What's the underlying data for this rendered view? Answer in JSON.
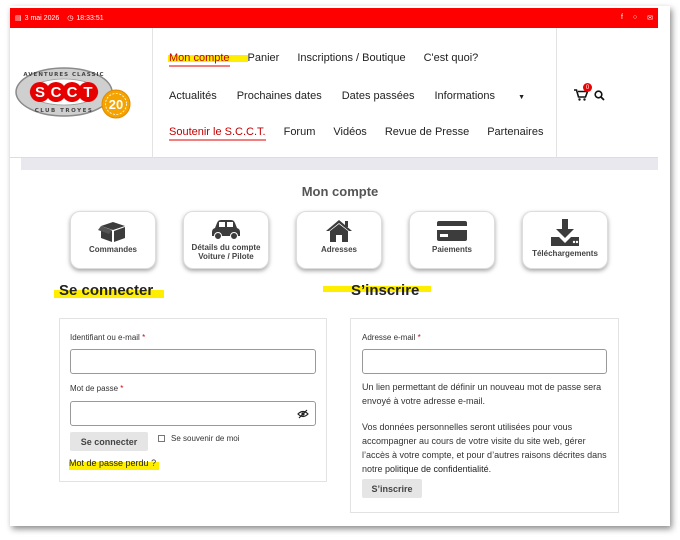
{
  "topbar": {
    "date": "3 mai 2026",
    "time": "18:33:51",
    "social_icons": [
      "facebook-icon",
      "instagram-icon",
      "mail-icon"
    ]
  },
  "logo": {
    "arc_top": "AVENTURES CLASSIC",
    "arc_bottom": "CLUB TROYES",
    "main": "SCCT",
    "badge": "20"
  },
  "nav": {
    "row1": [
      "Mon compte",
      "Panier",
      "Inscriptions / Boutique",
      "C'est quoi?"
    ],
    "row2": [
      "Actualités",
      "Prochaines dates",
      "Dates passées",
      "Informations"
    ],
    "row3": [
      "Soutenir le S.C.C.T.",
      "Forum",
      "Vidéos",
      "Revue de Presse",
      "Partenaires"
    ],
    "cart_count": "0"
  },
  "page_title": "Mon compte",
  "tiles": [
    {
      "icon": "box-icon",
      "label": "Commandes"
    },
    {
      "icon": "car-icon",
      "label": "Détails du compte Voiture / Pilote"
    },
    {
      "icon": "house-icon",
      "label": "Adresses"
    },
    {
      "icon": "credit-card-icon",
      "label": "Paiements"
    },
    {
      "icon": "download-icon",
      "label": "Téléchargements"
    }
  ],
  "login": {
    "title": "Se connecter",
    "username_label": "Identifiant ou e-mail",
    "password_label": "Mot de passe",
    "submit": "Se connecter",
    "remember": "Se souvenir de moi",
    "lost_link": "Mot de passe perdu",
    "lost_suffix": " ?"
  },
  "register": {
    "title": "S’inscrire",
    "email_label": "Adresse e-mail",
    "info": "Un lien permettant de définir un nouveau mot de passe sera envoyé à votre adresse e-mail.",
    "privacy_prefix": "Vos données personnelles seront utilisées pour vous accompagner au cours de votre visite du site web, gérer l’accès à votre compte, et pour d’autres raisons décrites dans notre ",
    "privacy_link": "politique de confidentialité",
    "privacy_suffix": ".",
    "submit": "S’inscrire"
  },
  "colors": {
    "brand_red": "#ff0000",
    "highlight": "#ffee00",
    "logo_orange": "#f5a300"
  }
}
